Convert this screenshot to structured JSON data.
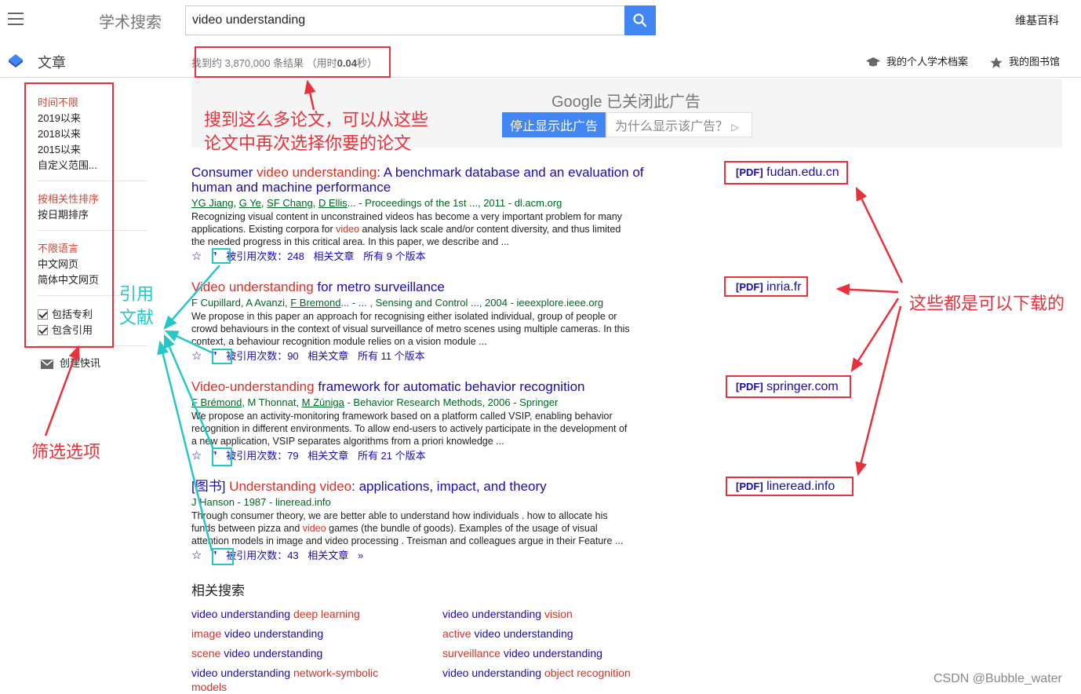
{
  "header": {
    "logo": "学术搜索",
    "search_value": "video understanding",
    "wiki": "维基百科"
  },
  "subbar": {
    "articles": "文章",
    "count_prefix": "找到约 3,870,000 条结果 （用时",
    "count_time": "0.04",
    "count_suffix": "秒）",
    "profile": "我的个人学术档案",
    "library": "我的图书馆"
  },
  "filters": {
    "time": [
      "时间不限",
      "2019以来",
      "2018以来",
      "2015以来",
      "自定义范围..."
    ],
    "sort": [
      "按相关性排序",
      "按日期排序"
    ],
    "lang": [
      "不限语言",
      "中文网页",
      "简体中文网页"
    ],
    "checks": [
      "包括专利",
      "包含引用"
    ],
    "alert": "创建快讯"
  },
  "ad": {
    "title": "Google 已关闭此广告",
    "stop": "停止显示此广告",
    "why": "为什么显示该广告？"
  },
  "results": [
    {
      "t1": "Consumer ",
      "t2": "video understanding",
      "t3": ": A benchmark database and an evaluation of human and machine performance",
      "authors": [
        "YG Jiang",
        "G Ye",
        "SF Chang",
        "D Ellis"
      ],
      "venue": "... - Proceedings of the 1st ..., 2011 - dl.acm.org",
      "s1": "Recognizing visual content in unconstrained videos has become a very important problem for many applications. Existing corpora for ",
      "s2": "video",
      "s3": " analysis lack scale and/or content diversity, and thus limited the needed progress in this critical area. In this paper, we describe and ...",
      "cited": "被引用次数：248",
      "related": "相关文章",
      "versions": "所有 9 个版本",
      "pdf_tag": "[PDF]",
      "pdf_site": "fudan.edu.cn"
    },
    {
      "t1": "",
      "t2": "Video understanding",
      "t3": " for metro surveillance",
      "authors_plain": "F Cupillard, A Avanzi, ",
      "authors": [
        "F Bremond"
      ],
      "venue": "... - ... , Sensing and Control ..., 2004 - ieeexplore.ieee.org",
      "s1": "We propose in this paper an approach for recognising either isolated individual, group of people or crowd behaviours in the context of visual surveillance of metro scenes using multiple cameras. In this context, a behaviour recognition module relies on a vision module ...",
      "s2": "",
      "s3": "",
      "cited": "被引用次数：90",
      "related": "相关文章",
      "versions": "所有 11 个版本",
      "pdf_tag": "[PDF]",
      "pdf_site": "inria.fr"
    },
    {
      "t1": "",
      "t2": "Video-understanding",
      "t3": " framework for automatic behavior recognition",
      "authors": [
        "F Brémond"
      ],
      "authors_mid": ", M Thonnat, ",
      "authors2": [
        "M Zúniga"
      ],
      "venue": " - Behavior Research Methods, 2006 - Springer",
      "s1": "We propose an activity-monitoring framework based on a platform called VSIP, enabling behavior recognition in different environments. To allow end-users to actively participate in the development of a new application, VSIP separates algorithms from a priori knowledge ...",
      "s2": "",
      "s3": "",
      "cited": "被引用次数：79",
      "related": "相关文章",
      "versions": "所有 21 个版本",
      "pdf_tag": "[PDF]",
      "pdf_site": "springer.com"
    },
    {
      "tag": "[图书] ",
      "t1": "",
      "t2": "Understanding video",
      "t3": ": applications, impact, and theory",
      "authors_plain": "J Hanson",
      "venue": " - 1987 - lineread.info",
      "s1": "Through consumer theory, we are better able to understand how individuals . how to allocate his funds between pizza and ",
      "s2": "video",
      "s3": " games (the bundle of goods). Examples of the usage of visual attention models in image and video processing . Treisman and colleagues argue in their Feature ...",
      "cited": "被引用次数：43",
      "related": "相关文章",
      "pdf_tag": "[PDF]",
      "pdf_site": "lineread.info"
    }
  ],
  "related_searches": {
    "title": "相关搜索",
    "items": [
      {
        "a": "video understanding ",
        "b": "deep learning"
      },
      {
        "a": "video understanding ",
        "b": "vision"
      },
      {
        "a": "",
        "b": "image",
        "c": " video understanding"
      },
      {
        "a": "",
        "b": "active",
        "c": " video understanding"
      },
      {
        "a": "",
        "b": "scene",
        "c": " video understanding"
      },
      {
        "a": "",
        "b": "surveillance",
        "c": " video understanding"
      },
      {
        "a": "video understanding ",
        "b": "network-symbolic models"
      },
      {
        "a": "video understanding ",
        "b": "object recognition"
      }
    ]
  },
  "annotations": {
    "results_note_1": "搜到这么多论文，可以从这些",
    "results_note_2": "论文中再次选择你要的论文",
    "cite_note_1": "引用",
    "cite_note_2": "文献",
    "pdf_note": "这些都是可以下载的",
    "filter_note": "筛选选项"
  },
  "watermark": "CSDN @Bubble_water",
  "colors": {
    "red_annotation": "#e8323b",
    "cyan_annotation": "#28c7c7",
    "link": "#1a0dab",
    "highlight": "#d93025",
    "search_blue": "#4285f4"
  }
}
